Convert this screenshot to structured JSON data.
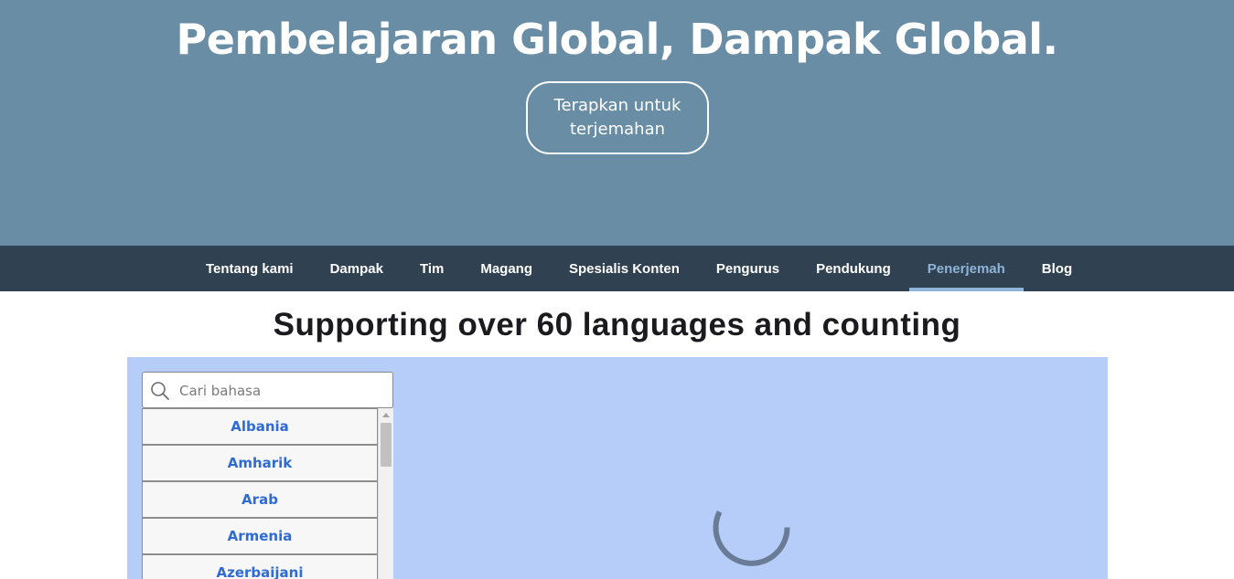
{
  "hero": {
    "title": "Pembelajaran Global, Dampak Global.",
    "cta_label": "Terapkan untuk terjemahan"
  },
  "nav": {
    "items": [
      {
        "label": "Tentang kami",
        "active": false
      },
      {
        "label": "Dampak",
        "active": false
      },
      {
        "label": "Tim",
        "active": false
      },
      {
        "label": "Magang",
        "active": false
      },
      {
        "label": "Spesialis Konten",
        "active": false
      },
      {
        "label": "Pengurus",
        "active": false
      },
      {
        "label": "Pendukung",
        "active": false
      },
      {
        "label": "Penerjemah",
        "active": true
      },
      {
        "label": "Blog",
        "active": false
      }
    ]
  },
  "section": {
    "title": "Supporting over 60 languages and counting"
  },
  "search": {
    "placeholder": "Cari bahasa",
    "value": "",
    "icon": "search-icon"
  },
  "languages": [
    "Albania",
    "Amharik",
    "Arab",
    "Armenia",
    "Azerbaijani"
  ],
  "colors": {
    "hero_bg": "#6a8da6",
    "nav_bg": "#304251",
    "nav_active": "#8fb4d9",
    "panel_bg": "#b5cdf8",
    "language_link": "#2e6bd4",
    "spinner": "#6a7b96"
  },
  "loading_icon": "loading-spinner-icon"
}
